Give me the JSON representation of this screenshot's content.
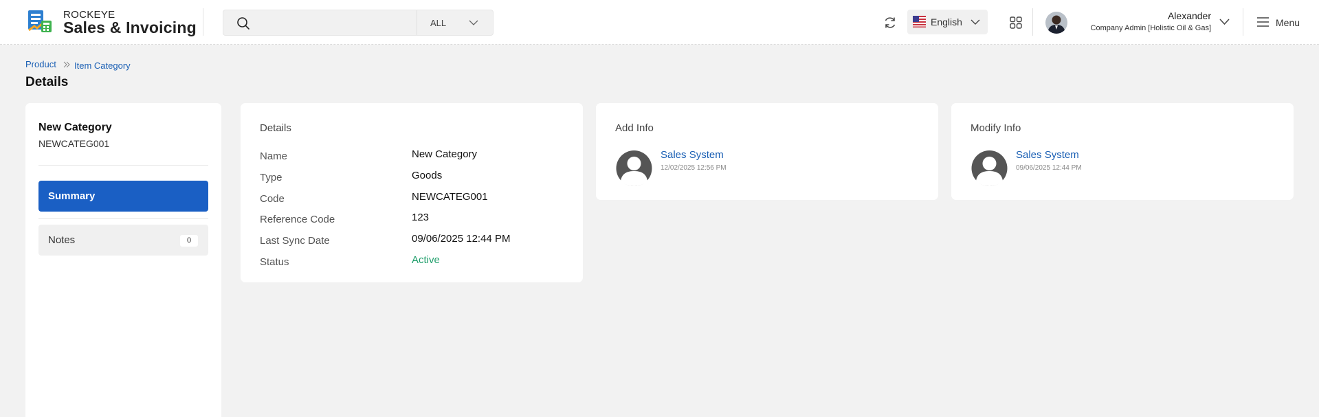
{
  "header": {
    "brand_top": "ROCKEYE",
    "brand_bottom": "Sales & Invoicing",
    "search": {
      "placeholder": "",
      "scope": "ALL"
    },
    "language": "English",
    "user": {
      "name": "Alexander",
      "role": "Company Admin [Holistic Oil & Gas]"
    },
    "menu_label": "Menu"
  },
  "breadcrumb": [
    "Product",
    "Item Category"
  ],
  "page_title": "Details",
  "sidebar": {
    "title": "New Category",
    "code": "NEWCATEG001",
    "tabs": [
      {
        "label": "Summary",
        "active": true
      },
      {
        "label": "Notes",
        "count": "0"
      }
    ]
  },
  "details": {
    "heading": "Details",
    "rows": [
      {
        "label": "Name",
        "value": "New Category"
      },
      {
        "label": "Type",
        "value": "Goods"
      },
      {
        "label": "Code",
        "value": "NEWCATEG001"
      },
      {
        "label": "Reference Code",
        "value": "123"
      },
      {
        "label": "Last Sync Date",
        "value": "09/06/2025 12:44 PM"
      },
      {
        "label": "Status",
        "value": "Active"
      }
    ]
  },
  "add_info": {
    "heading": "Add Info",
    "name": "Sales System",
    "date": "12/02/2025 12:56 PM"
  },
  "modify_info": {
    "heading": "Modify Info",
    "name": "Sales System",
    "date": "09/06/2025 12:44 PM"
  },
  "colors": {
    "primary": "#1a5fc4",
    "link": "#1a5fb4",
    "status_active": "#1e9e6a",
    "page_bg": "#f2f2f2"
  }
}
